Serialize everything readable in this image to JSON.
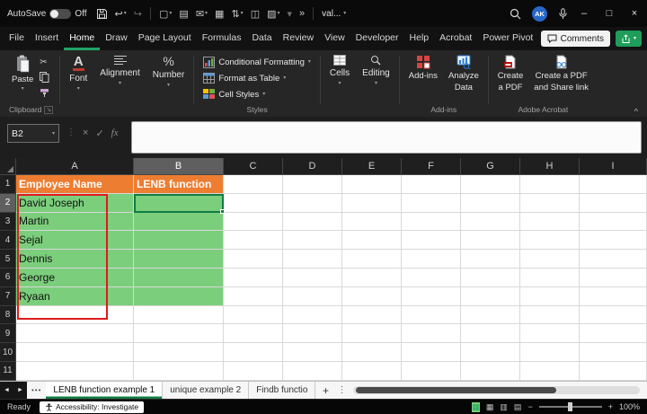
{
  "titlebar": {
    "autosave_label": "AutoSave",
    "autosave_state": "Off",
    "workbook_name": "val...",
    "avatar_initials": "AK"
  },
  "icons": {
    "dropdown": "▾",
    "undo": "↩",
    "redo": "↪",
    "overflow": "»",
    "more_dots": "⋮",
    "cancel": "×",
    "check": "✓",
    "fx": "fx",
    "minimize": "–",
    "maximize": "□",
    "close": "×",
    "caret_up": "^",
    "launcher": "↘",
    "font_a": "A",
    "percent": "%",
    "scissors": "✂",
    "qat": [
      "▢",
      "▤",
      "✉",
      "▦",
      "⇅",
      "◫",
      "▨"
    ],
    "tab_dots": "•••",
    "add_sheet": "+",
    "nav_left": "◄",
    "nav_right": "►",
    "view_icons": [
      "▦",
      "▥",
      "▤"
    ],
    "sheet_green": "▦",
    "zoom_minus": "−",
    "zoom_plus": "+"
  },
  "ribbon_tabs": [
    "File",
    "Insert",
    "Home",
    "Draw",
    "Page Layout",
    "Formulas",
    "Data",
    "Review",
    "View",
    "Developer",
    "Help",
    "Acrobat",
    "Power Pivot"
  ],
  "topright": {
    "comments": "Comments"
  },
  "ribbon": {
    "paste": "Paste",
    "group_clipboard": "Clipboard",
    "font": "Font",
    "alignment": "Alignment",
    "number": "Number",
    "conditional_formatting": "Conditional Formatting",
    "format_as_table": "Format as Table",
    "cell_styles": "Cell Styles",
    "group_styles": "Styles",
    "cells": "Cells",
    "editing": "Editing",
    "addins": "Add-ins",
    "group_addins": "Add-ins",
    "analyze1": "Analyze",
    "analyze2": "Data",
    "pdf1": "Create",
    "pdf2": "a PDF",
    "share1": "Create a PDF",
    "share2": "and Share link",
    "group_acrobat": "Adobe Acrobat"
  },
  "formula_bar": {
    "name_box": "B2",
    "value": ""
  },
  "grid": {
    "columns": [
      "A",
      "B",
      "C",
      "D",
      "E",
      "F",
      "G",
      "H",
      "I"
    ],
    "rows": [
      "1",
      "2",
      "3",
      "4",
      "5",
      "6",
      "7",
      "8",
      "9",
      "10",
      "11"
    ],
    "a1": "Employee Name",
    "b1": "LENB function",
    "names": [
      "David Joseph",
      "Martin",
      "Sejal",
      "Dennis",
      "George",
      "Ryaan"
    ],
    "selected_cell": "B2"
  },
  "colors": {
    "accent_green": "#107C41",
    "header_orange": "#ED7D31",
    "cell_green": "#7BCE7C",
    "annotation_red": "#E01A1A"
  },
  "sheet_tabs": [
    "LENB function example 1",
    "unique example 2",
    "Findb functio"
  ],
  "status_bar": {
    "ready": "Ready",
    "accessibility": "Accessibility: Investigate",
    "zoom": "100%"
  }
}
